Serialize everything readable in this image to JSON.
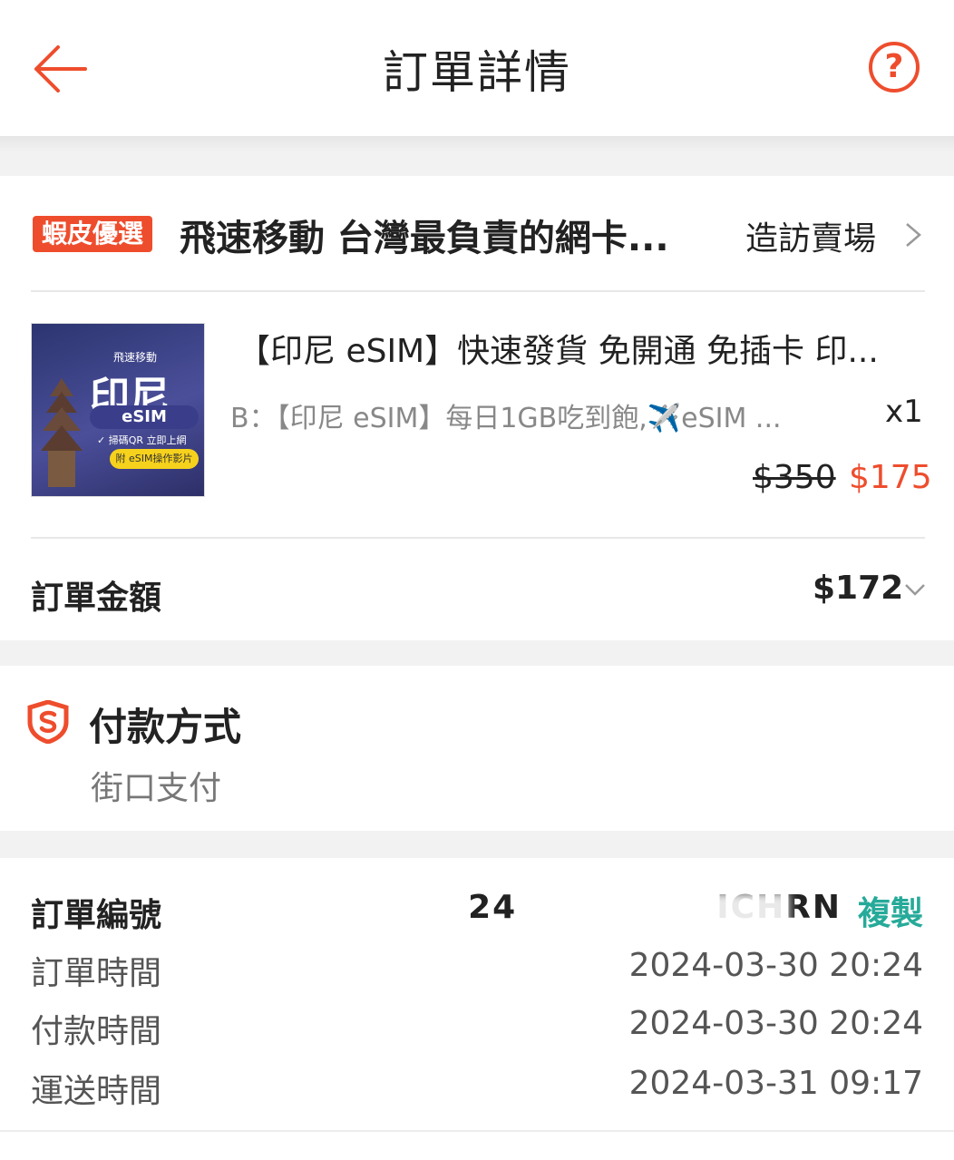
{
  "header": {
    "title": "訂單詳情",
    "back_icon": "arrow-left-icon",
    "help_icon": "question-circle-icon",
    "help_glyph": "?"
  },
  "shop": {
    "badge": "蝦皮優選",
    "name": "飛速移動 台灣最負責的網卡...",
    "visit_label": "造訪賣場"
  },
  "product": {
    "thumb_brand": "飛速移動",
    "thumb_title": "印尼",
    "thumb_esim": "eSIM",
    "thumb_line": "✓ 掃碼QR  立即上網",
    "thumb_video": "附 eSIM操作影片",
    "name": "【印尼 eSIM】快速發貨 免開通 免插卡 印...",
    "variant": "B：【印尼 eSIM】每日1GB吃到飽,✈️eSIM ...",
    "quantity": "x1",
    "original_price": "$350",
    "price": "$175"
  },
  "order_total": {
    "label": "訂單金額",
    "value": "$172"
  },
  "payment": {
    "title": "付款方式",
    "method": "街口支付",
    "accent": "#ee4d2d"
  },
  "order_info": {
    "order_no_label": "訂單編號",
    "order_no_value": "24",
    "order_no_tail": "ICHRN",
    "copy_label": "複製",
    "rows": [
      {
        "label": "訂單時間",
        "value": "2024-03-30 20:24"
      },
      {
        "label": "付款時間",
        "value": "2024-03-30 20:24"
      },
      {
        "label": "運送時間",
        "value": "2024-03-31 09:17"
      }
    ]
  },
  "colors": {
    "brand": "#ee4d2d",
    "copy": "#26aa99"
  }
}
